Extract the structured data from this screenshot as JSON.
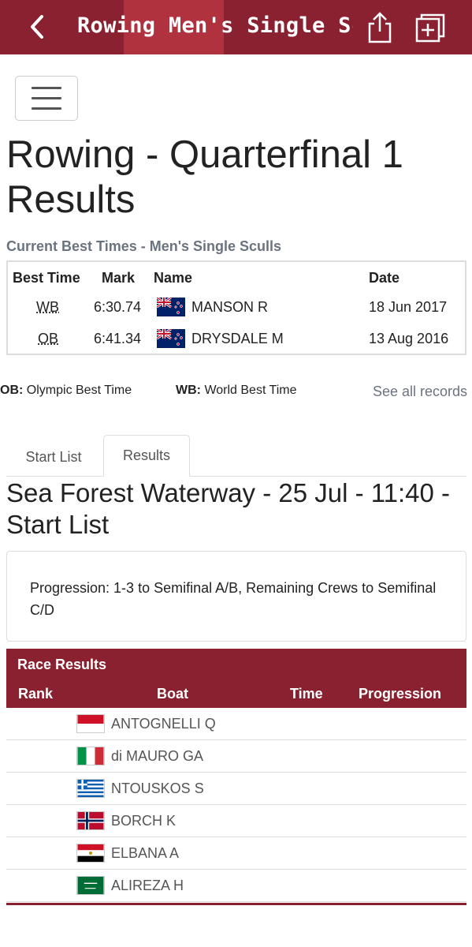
{
  "appbar": {
    "title": "Rowing Men's Single Scull...",
    "back_icon": "chevron-left-icon",
    "share_icon": "share-icon",
    "add_icon": "add-tab-icon"
  },
  "page": {
    "title": "Rowing - Quarterfinal 1 Results"
  },
  "records": {
    "caption": "Current Best Times - Men's Single Sculls",
    "headers": [
      "Best Time",
      "Mark",
      "Name",
      "Date"
    ],
    "rows": [
      {
        "type": "WB",
        "mark": "6:30.74",
        "name": "MANSON R",
        "date": "18 Jun 2017"
      },
      {
        "type": "OB",
        "mark": "6:41.34",
        "name": "DRYSDALE M",
        "date": "13 Aug 2016"
      }
    ]
  },
  "legend": {
    "ob_key": "OB:",
    "ob_text": "Olympic Best Time",
    "wb_key": "WB:",
    "wb_text": "World Best Time",
    "see_all": "See all records"
  },
  "tabs": [
    {
      "label": "Start List"
    },
    {
      "label": "Results"
    }
  ],
  "venue_title": "Sea Forest Waterway - 25 Jul - 11:40 - Start List",
  "progression": "Progression: 1-3 to Semifinal A/B, Remaining Crews to Semifinal C/D",
  "results": {
    "caption": "Race Results",
    "headers": [
      "Rank",
      "Boat",
      "Time",
      "Progression"
    ],
    "rows": [
      {
        "name": "ANTOGNELLI Q",
        "flag": "monaco"
      },
      {
        "name": "di MAURO GA",
        "flag": "italy"
      },
      {
        "name": "NTOUSKOS S",
        "flag": "greece"
      },
      {
        "name": "BORCH K",
        "flag": "norway"
      },
      {
        "name": "ELBANA A",
        "flag": "egypt"
      },
      {
        "name": "ALIREZA H",
        "flag": "saudi-arabia"
      }
    ]
  },
  "colors": {
    "brand": "#8a2130",
    "highlight": "#b0323f",
    "muted": "#6b7280"
  }
}
